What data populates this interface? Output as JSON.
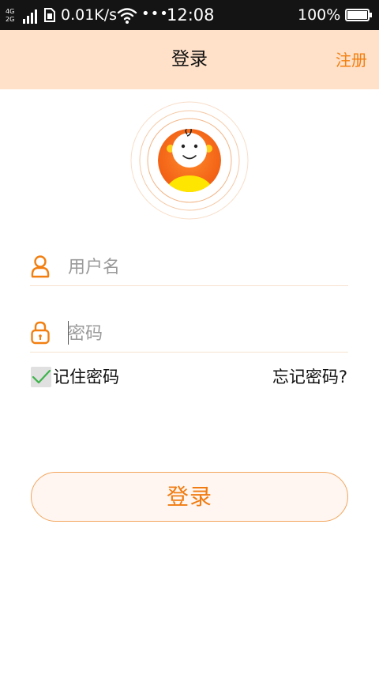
{
  "status_bar": {
    "network_top": "4G",
    "network_bottom": "2G",
    "speed": "0.01K/s",
    "more": "•••",
    "time": "12:08",
    "battery": "100%",
    "battery_level": 1.0
  },
  "header": {
    "title": "登录",
    "register_label": "注册"
  },
  "form": {
    "username_placeholder": "用户名",
    "username_value": "",
    "password_placeholder": "密码",
    "password_value": "",
    "remember_label": "记住密码",
    "remember_checked": true,
    "forgot_label": "忘记密码?"
  },
  "login_button": {
    "label": "登录"
  },
  "colors": {
    "accent": "#f27f10",
    "header_bg": "#ffe0c8",
    "check_green": "#3cb34a"
  },
  "icons": {
    "avatar": "cartoon-baby-avatar",
    "username": "user-icon",
    "password": "lock-icon",
    "checkbox": "check-icon"
  }
}
